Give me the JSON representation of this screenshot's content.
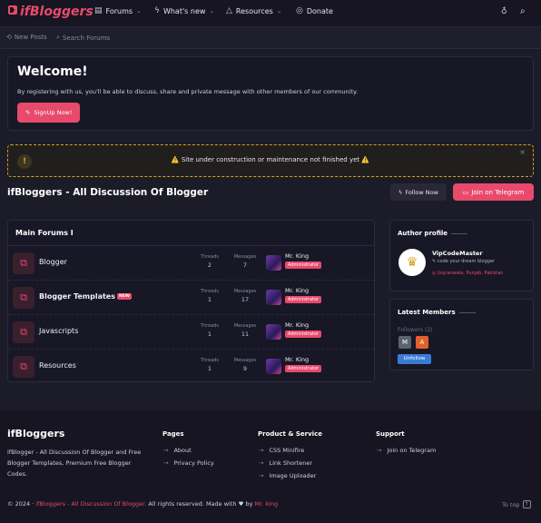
{
  "brand": {
    "name": "ifBloggers",
    "accent": "#e84a6c"
  },
  "nav": {
    "items": [
      {
        "label": "Forums",
        "icon": "forums-icon",
        "glyph": "▤",
        "chevron": true
      },
      {
        "label": "What's new",
        "icon": "bolt-icon",
        "glyph": "ϟ",
        "chevron": true
      },
      {
        "label": "Resources",
        "icon": "resources-icon",
        "glyph": "△",
        "chevron": true
      },
      {
        "label": "Donate",
        "icon": "donate-icon",
        "glyph": "◎",
        "chevron": false
      }
    ]
  },
  "subnav": {
    "new_posts": "New Posts",
    "search_forums": "Search Forums"
  },
  "welcome": {
    "title": "Welcome!",
    "text": "By registering with us, you'll be able to discuss, share and private message with other members of our community.",
    "signup_label": "SignUp Now!"
  },
  "notice": {
    "text": "⚠️ Site under construction or maintenance not finished yet ⚠️",
    "close": "×"
  },
  "page": {
    "title": "ifBloggers - All Discussion Of Blogger",
    "follow_label": "Follow Now",
    "telegram_label": "Join on Telegram"
  },
  "forums": {
    "heading": "Main Forums I",
    "threads_label": "Threads",
    "messages_label": "Messages",
    "rows": [
      {
        "title": "Blogger",
        "bold": false,
        "new": "",
        "threads": "2",
        "messages": "7",
        "user": "Mr. King",
        "role": "Administrator"
      },
      {
        "title": "Blogger Templates",
        "bold": true,
        "new": "NEW",
        "threads": "1",
        "messages": "17",
        "user": "Mr. King",
        "role": "Administrator"
      },
      {
        "title": "Javascripts",
        "bold": false,
        "new": "",
        "threads": "1",
        "messages": "11",
        "user": "Mr. King",
        "role": "Administrator"
      },
      {
        "title": "Resources",
        "bold": false,
        "new": "",
        "threads": "1",
        "messages": "9",
        "user": "Mr. King",
        "role": "Administrator"
      }
    ]
  },
  "author": {
    "title": "Author profile",
    "name": "VipCodeMaster",
    "tagline": "code your dream blogger",
    "location": "Gujranwala, Punjab, Pakistan"
  },
  "members": {
    "title": "Latest Members",
    "followers": "Followers (2)",
    "tiles": [
      {
        "letter": "M",
        "color": "#5a6470"
      },
      {
        "letter": "A",
        "color": "#e2612a"
      }
    ],
    "unfollow": "Unfollow"
  },
  "footer": {
    "brand": "ifBloggers",
    "description": "ifBlogger - All Discussion Of Blogger and Free Blogger Templates, Premium Free Blogger Codes.",
    "pages_title": "Pages",
    "pages": [
      "About",
      "Privacy Policy"
    ],
    "products_title": "Product & Service",
    "products": [
      "CSS Minifire",
      "Link Shortener",
      "Image Uploader"
    ],
    "support_title": "Support",
    "support": [
      "Join on Telegram"
    ],
    "copy_prefix": "© 2024 ·",
    "copy_site": "ifBloggers - All Discussion Of Blogger.",
    "copy_mid": "All rights reserved. Made with ♥ by",
    "copy_author": "Mr. king",
    "to_top": "To top"
  }
}
